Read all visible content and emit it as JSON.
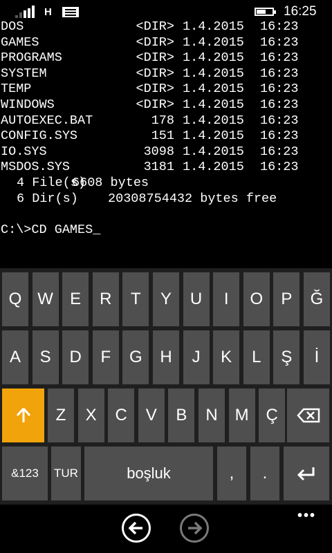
{
  "status_bar": {
    "network": "H",
    "time": "16:25",
    "battery_level": 0.6
  },
  "console": {
    "entries": [
      {
        "name": "DOS",
        "size": "<DIR>",
        "date": "1.4.2015",
        "time": "16:23"
      },
      {
        "name": "GAMES",
        "size": "<DIR>",
        "date": "1.4.2015",
        "time": "16:23"
      },
      {
        "name": "PROGRAMS",
        "size": "<DIR>",
        "date": "1.4.2015",
        "time": "16:23"
      },
      {
        "name": "SYSTEM",
        "size": "<DIR>",
        "date": "1.4.2015",
        "time": "16:23"
      },
      {
        "name": "TEMP",
        "size": "<DIR>",
        "date": "1.4.2015",
        "time": "16:23"
      },
      {
        "name": "WINDOWS",
        "size": "<DIR>",
        "date": "1.4.2015",
        "time": "16:23"
      },
      {
        "name": "AUTOEXEC.BAT",
        "size": "178",
        "date": "1.4.2015",
        "time": "16:23"
      },
      {
        "name": "CONFIG.SYS",
        "size": "151",
        "date": "1.4.2015",
        "time": "16:23"
      },
      {
        "name": "IO.SYS",
        "size": "3098",
        "date": "1.4.2015",
        "time": "16:23"
      },
      {
        "name": "MSDOS.SYS",
        "size": "3181",
        "date": "1.4.2015",
        "time": "16:23"
      }
    ],
    "summary_files_count": "4 File(s)",
    "summary_files_bytes": "6608 bytes",
    "summary_dirs_count": "6 Dir(s)",
    "summary_dirs_bytes": "20308754432 bytes free",
    "prompt": "C:\\>CD GAMES_"
  },
  "keyboard": {
    "row1": [
      "Q",
      "W",
      "E",
      "R",
      "T",
      "Y",
      "U",
      "I",
      "O",
      "P",
      "Ğ"
    ],
    "row2": [
      "A",
      "S",
      "D",
      "F",
      "G",
      "H",
      "J",
      "K",
      "L",
      "Ş",
      "İ"
    ],
    "row3": [
      "Z",
      "X",
      "C",
      "V",
      "B",
      "N",
      "M",
      "Ç"
    ],
    "shift_icon": "shift-arrow-up-icon",
    "backspace_icon": "backspace-icon",
    "symbols_label": "&123",
    "language_label": "TUR",
    "space_label": "boşluk",
    "comma_label": ",",
    "period_label": ".",
    "enter_icon": "enter-icon",
    "accent_color": "#f0a30a"
  },
  "nav": {
    "back_icon": "back-arrow-icon",
    "forward_icon": "forward-arrow-icon",
    "more_label": "•••"
  }
}
